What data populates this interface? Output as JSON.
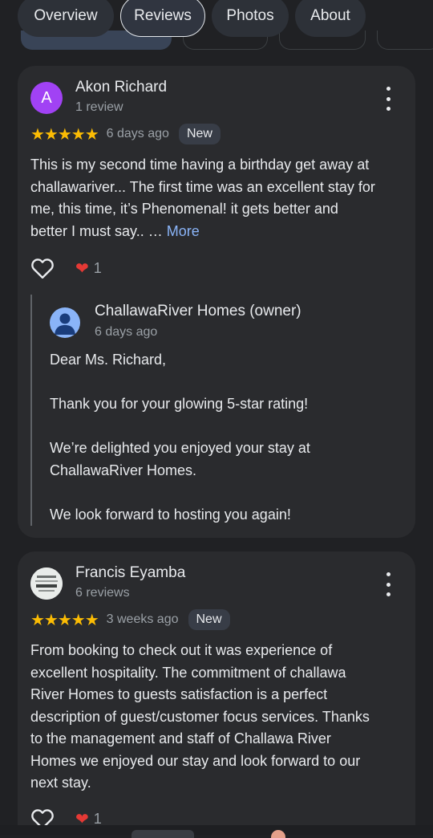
{
  "tabs": [
    {
      "label": "Overview",
      "active": false
    },
    {
      "label": "Reviews",
      "active": true
    },
    {
      "label": "Photos",
      "active": false
    },
    {
      "label": "About",
      "active": false
    }
  ],
  "reviews": [
    {
      "avatar_letter": "A",
      "avatar_color": "#a142f4",
      "name": "Akon Richard",
      "review_count": "1 review",
      "stars": "★★★★★",
      "rating": 5,
      "time": "6 days ago",
      "badge": "New",
      "text_lines": [
        "This is my second time having a birthday get away at",
        "challawariver... The first time was an excellent stay for",
        "me, this time, it’s Phenomenal! it gets better and",
        "better I must say.. …"
      ],
      "more_label": "More",
      "likes": "1",
      "owner_reply": {
        "name": "ChallawaRiver Homes (owner)",
        "time": "6 days ago",
        "lines": [
          "Dear Ms. Richard,",
          "",
          "Thank you for your glowing 5-star rating!",
          "",
          "We’re delighted you enjoyed your stay at",
          "ChallawaRiver Homes.",
          "",
          "We look forward to hosting you again!"
        ]
      }
    },
    {
      "avatar_letter": "",
      "name": "Francis Eyamba",
      "review_count": "6 reviews",
      "stars": "★★★★★",
      "rating": 5,
      "time": "3 weeks ago",
      "badge": "New",
      "text_lines": [
        "From booking to check out it was experience of",
        "excellent hospitality. The commitment of challawa",
        "River Homes to guests satisfaction is a perfect",
        "description of guest/customer focus services. Thanks",
        "to the management and staff of Challawa River",
        "Homes we enjoyed our stay and look forward to our",
        "next stay."
      ],
      "likes": "1"
    }
  ],
  "colors": {
    "background": "#202124",
    "card": "#2a2b2e",
    "star": "#fbbc04",
    "link": "#8ab4f8",
    "heart": "#e53935"
  }
}
